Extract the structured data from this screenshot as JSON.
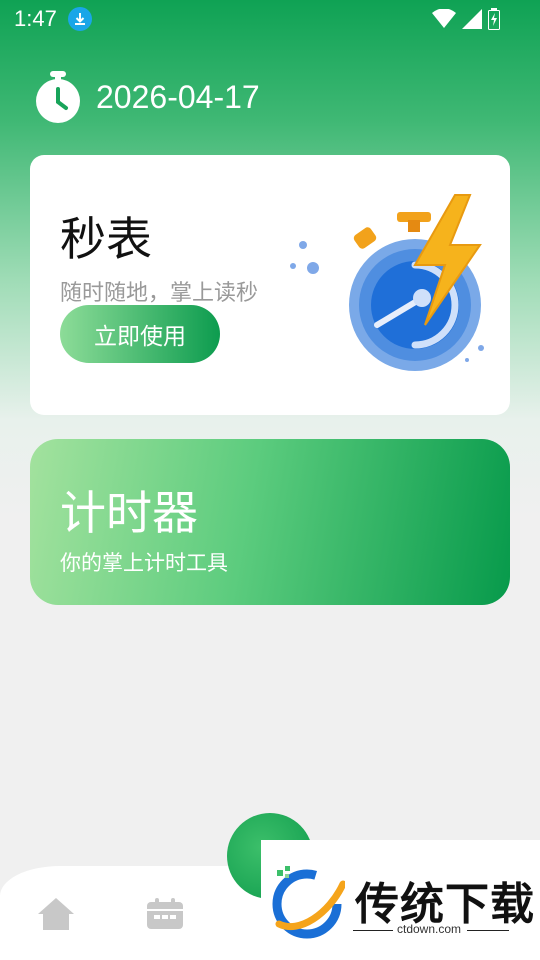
{
  "status_bar": {
    "time": "1:47"
  },
  "header": {
    "date": "2026-04-17"
  },
  "stopwatch_card": {
    "title": "秒表",
    "subtitle": "随时随地，掌上读秒",
    "button_label": "立即使用"
  },
  "timer_card": {
    "title": "计时器",
    "subtitle": "你的掌上计时工具"
  },
  "watermark": {
    "brand": "传统下载",
    "url": "ctdown.com"
  },
  "colors": {
    "primary_green": "#0fa254",
    "button_gradient_start": "#8ddc98",
    "button_gradient_end": "#0d9c4f",
    "nav_icon_gray": "#c8c8c8"
  }
}
